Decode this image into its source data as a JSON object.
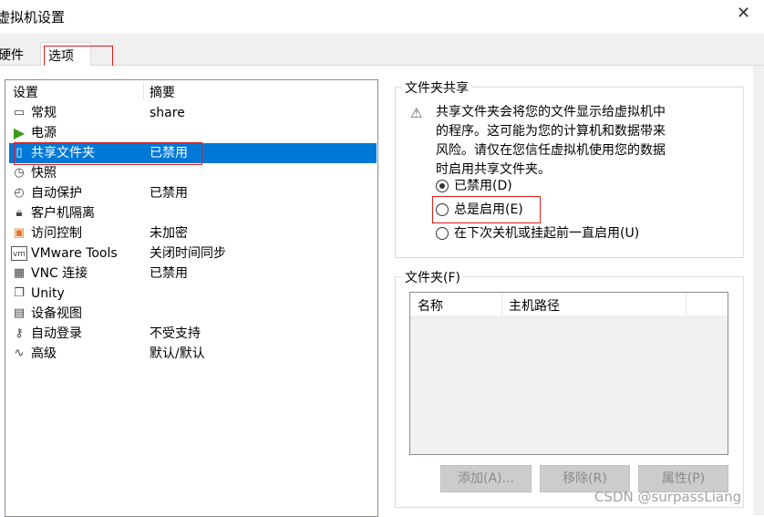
{
  "window": {
    "title": "虚拟机设置",
    "close": "✕"
  },
  "tabs": [
    {
      "label": "硬件"
    },
    {
      "label": "选项"
    }
  ],
  "list": {
    "headers": {
      "setting": "设置",
      "summary": "摘要"
    },
    "items": [
      {
        "label": "常规",
        "summary": "share",
        "icon": "monitor-icon"
      },
      {
        "label": "电源",
        "summary": "",
        "icon": "power-play-icon"
      },
      {
        "label": "共享文件夹",
        "summary": "已禁用",
        "icon": "shared-folder-icon",
        "selected": true
      },
      {
        "label": "快照",
        "summary": "",
        "icon": "snapshot-icon"
      },
      {
        "label": "自动保护",
        "summary": "已禁用",
        "icon": "autoprotect-icon"
      },
      {
        "label": "客户机隔离",
        "summary": "",
        "icon": "lock-icon"
      },
      {
        "label": "访问控制",
        "summary": "未加密",
        "icon": "access-control-icon"
      },
      {
        "label": "VMware Tools",
        "summary": "关闭时间同步",
        "icon": "vmware-tools-icon"
      },
      {
        "label": "VNC 连接",
        "summary": "已禁用",
        "icon": "vnc-icon"
      },
      {
        "label": "Unity",
        "summary": "",
        "icon": "unity-icon"
      },
      {
        "label": "设备视图",
        "summary": "",
        "icon": "device-view-icon"
      },
      {
        "label": "自动登录",
        "summary": "不受支持",
        "icon": "autologin-icon"
      },
      {
        "label": "高级",
        "summary": "默认/默认",
        "icon": "advanced-icon"
      }
    ]
  },
  "sharing": {
    "legend": "文件夹共享",
    "warning": [
      "共享文件夹会将您的文件显示给虚拟机中",
      "的程序。这可能为您的计算机和数据带来",
      "风险。请仅在您信任虚拟机使用您的数据",
      "时启用共享文件夹。"
    ],
    "options": [
      {
        "label": "已禁用(D)",
        "checked": true
      },
      {
        "label": "总是启用(E)",
        "checked": false
      },
      {
        "label": "在下次关机或挂起前一直启用(U)",
        "checked": false
      }
    ]
  },
  "folders": {
    "legend": "文件夹(F)",
    "columns": [
      "名称",
      "主机路径"
    ],
    "buttons": {
      "add": "添加(A)...",
      "remove": "移除(R)",
      "properties": "属性(P)"
    }
  },
  "watermark": "CSDN @surpassLiang"
}
